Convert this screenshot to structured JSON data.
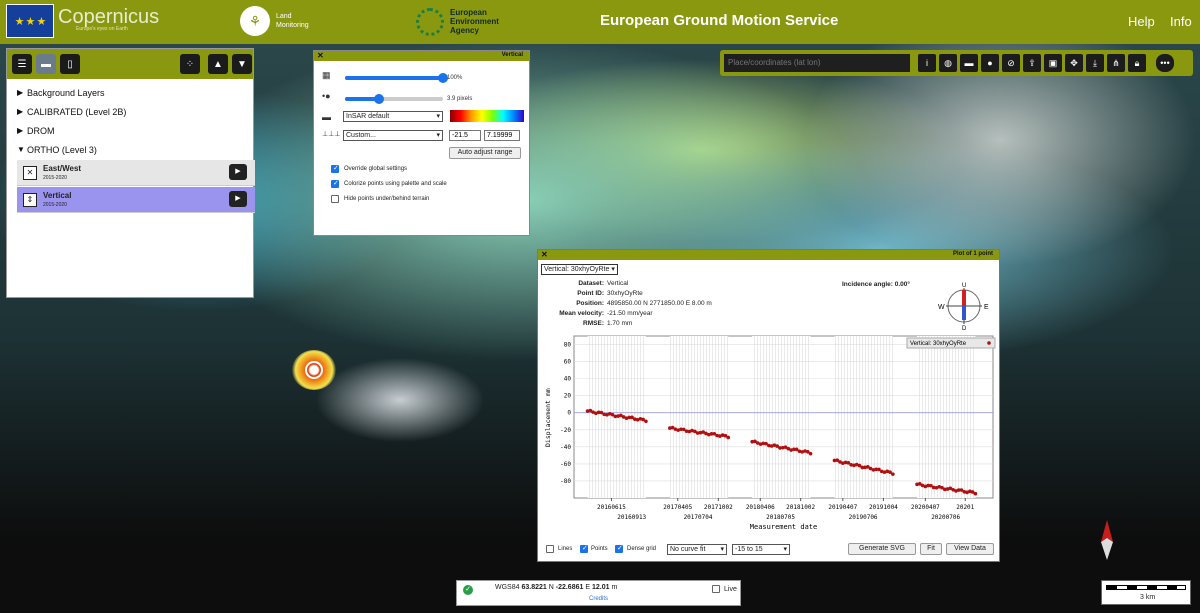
{
  "header": {
    "eu_flag_stars": "★ ★ ★",
    "copernicus_logo": "Copernicus",
    "copernicus_tagline": "Europe's eyes on Earth",
    "land_monitoring": "Land Monitoring",
    "eea": "European Environment Agency",
    "title": "European Ground Motion Service",
    "help": "Help",
    "info": "Info"
  },
  "layers": {
    "items": [
      {
        "label": "Background Layers",
        "expanded": false
      },
      {
        "label": "CALIBRATED (Level 2B)",
        "expanded": false
      },
      {
        "label": "DROM",
        "expanded": false
      },
      {
        "label": "ORTHO (Level 3)",
        "expanded": true
      }
    ],
    "sub": [
      {
        "name": "East/West",
        "years": "2015-2020",
        "selected": false
      },
      {
        "name": "Vertical",
        "years": "2015-2020",
        "selected": true
      }
    ]
  },
  "style_dialog": {
    "title": "Vertical",
    "opacity_label": "100%",
    "opacity_value": 1.0,
    "size_label": "3.9 pixels",
    "size_value": 0.35,
    "palette": "InSAR default",
    "range_mode": "Custom...",
    "range_min": "-21.5",
    "range_max": "7.19999",
    "auto_btn": "Auto adjust range",
    "opt1": "Override global settings",
    "opt2": "Colorize points using palette and scale",
    "opt3": "Hide points under/behind terrain"
  },
  "map_tools": {
    "search_placeholder": "Place/coordinates (lat lon)",
    "more": "•••"
  },
  "plot": {
    "title": "Plot of 1 point",
    "selector": "Vertical: 30xhyOyRte",
    "dataset_label": "Dataset:",
    "dataset": "Vertical",
    "pointid_label": "Point ID:",
    "pointid": "30xhyOyRte",
    "position_label": "Position:",
    "position": "4895850.00 N 2771850.00 E 8.00 m",
    "velocity_label": "Mean velocity:",
    "velocity": "-21.50 mm/year",
    "rmse_label": "RMSE:",
    "rmse": "1.70 mm",
    "incidence": "Incidence angle: 0.00°",
    "compass_w": "W",
    "compass_e": "E",
    "compass_u": "U",
    "compass_d": "D",
    "legend": "Vertical: 30xhyOyRte",
    "lines_label": "Lines",
    "points_label": "Points",
    "dense_label": "Dense grid",
    "curve_fit": "No curve fit",
    "range": "-15 to 15",
    "gen_svg": "Generate SVG",
    "fit": "Fit",
    "view_data": "View Data"
  },
  "chart_data": {
    "type": "scatter",
    "ylabel": "Displacement mm",
    "xlabel": "Measurement date",
    "ylim": [
      -100,
      90
    ],
    "yticks": [
      80,
      60,
      40,
      20,
      0,
      -20,
      -40,
      -60,
      -80
    ],
    "xticks_upper": [
      "20160615",
      "20170405",
      "20171002",
      "20180406",
      "20181002",
      "20190407",
      "20191004",
      "20200407",
      "20201"
    ],
    "xticks_lower": [
      "20160913",
      "20170704",
      "20180705",
      "20190706",
      "20200706"
    ],
    "series": [
      {
        "name": "Vertical: 30xhyOyRte",
        "color": "#b01010",
        "segments": [
          {
            "x_start": "2016-03",
            "x_end": "2016-11",
            "y_start": 2,
            "y_end": -9
          },
          {
            "x_start": "2017-03",
            "x_end": "2017-11",
            "y_start": -18,
            "y_end": -28
          },
          {
            "x_start": "2018-03",
            "x_end": "2018-11",
            "y_start": -34,
            "y_end": -47
          },
          {
            "x_start": "2019-03",
            "x_end": "2019-11",
            "y_start": -56,
            "y_end": -71
          },
          {
            "x_start": "2020-03",
            "x_end": "2020-11",
            "y_start": -84,
            "y_end": -94
          }
        ]
      }
    ],
    "grid": true,
    "legend_position": "top-right"
  },
  "coords": {
    "crs": "WGS84",
    "lat": "63.8221",
    "lat_dir": "N",
    "lon": "-22.6861",
    "lon_dir": "E",
    "alt": "12.01",
    "alt_unit": "m",
    "credits": "Credits",
    "live": "Live"
  },
  "scale": {
    "label": "3 km"
  }
}
